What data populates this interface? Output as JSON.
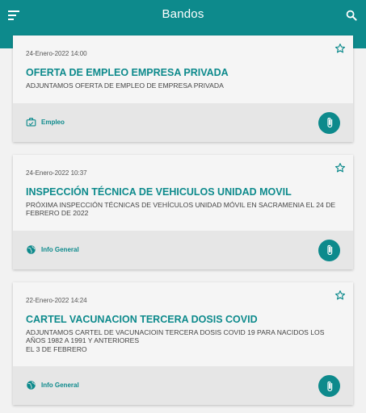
{
  "appbar": {
    "title": "Bandos",
    "menu_icon": "menu-icon",
    "search_icon": "search-icon",
    "color": "#0d8a8c"
  },
  "bandos": [
    {
      "date": "24-Enero-2022 14:00",
      "title": "OFERTA DE EMPLEO EMPRESA PRIVADA",
      "description": "ADJUNTAMOS OFERTA DE EMPLEO DE EMPRESA PRIVADA",
      "category": "Empleo",
      "category_icon": "briefcase-icon"
    },
    {
      "date": "24-Enero-2022 10:37",
      "title": "INSPECCIÓN TÉCNICA DE VEHICULOS UNIDAD MOVIL",
      "description": "PRÓXIMA INSPECCIÓN TÉCNICAS DE VEHÍCULOS  UNIDAD MÓVIL EN SACRAMENIA EL 24 DE FEBRERO DE 2022",
      "category": "Info General",
      "category_icon": "globe-icon"
    },
    {
      "date": "22-Enero-2022 14:24",
      "title": "CARTEL VACUNACION TERCERA DOSIS COVID",
      "description": "ADJUNTAMOS CARTEL DE VACUNACIOIN TERCERA DOSIS COVID 19 PARA NACIDOS LOS AÑOS 1982 A 1991 Y ANTERIORES\nEL 3 DE FEBRERO",
      "category": "Info General",
      "category_icon": "globe-icon"
    }
  ]
}
